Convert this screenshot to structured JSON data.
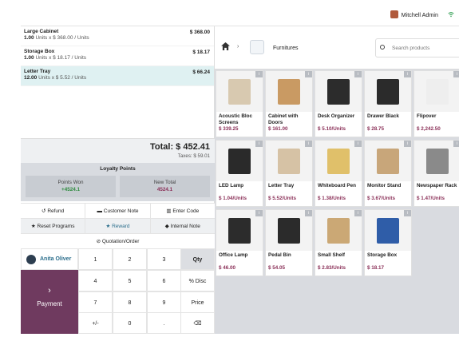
{
  "topbar": {
    "user_name": "Mitchell Admin"
  },
  "orderlines": [
    {
      "name": "Large Cabinet",
      "qty": "1.00",
      "detail": "Units x $ 368.00 / Units",
      "price": "$ 368.00",
      "selected": false
    },
    {
      "name": "Storage Box",
      "qty": "1.00",
      "detail": "Units x $ 18.17 / Units",
      "price": "$ 18.17",
      "selected": false
    },
    {
      "name": "Letter Tray",
      "qty": "12.00",
      "detail": "Units x $ 5.52 / Units",
      "price": "$ 66.24",
      "selected": true
    }
  ],
  "totals": {
    "total": "Total: $ 452.41",
    "taxes": "Taxes: $ 59.01"
  },
  "loyalty": {
    "header": "Loyalty Points",
    "won_label": "Points Won",
    "won_value": "+4524.1",
    "new_label": "New Total",
    "new_value": "4524.1"
  },
  "actions": {
    "refund": "Refund",
    "customer_note": "Customer Note",
    "enter_code": "Enter Code",
    "reset_programs": "Reset Programs",
    "reward": "Reward",
    "internal_note": "Internal Note",
    "quotation": "Quotation/Order"
  },
  "customer": {
    "name": "Anita Oliver"
  },
  "payment": {
    "label": "Payment"
  },
  "numpad": {
    "k1": "1",
    "k2": "2",
    "k3": "3",
    "qty": "Qty",
    "k4": "4",
    "k5": "5",
    "k6": "6",
    "disc": "% Disc",
    "k7": "7",
    "k8": "8",
    "k9": "9",
    "price": "Price",
    "sign": "+/-",
    "k0": "0",
    "dot": ".",
    "back": "⌫"
  },
  "category": {
    "label": "Furnitures",
    "search_placeholder": "Search products"
  },
  "products": [
    {
      "name": "Acoustic Bloc Screens",
      "price": "$ 339.25"
    },
    {
      "name": "Cabinet with Doors",
      "price": "$ 161.00"
    },
    {
      "name": "Desk Organizer",
      "price": "$ 5.10/Units"
    },
    {
      "name": "Drawer Black",
      "price": "$ 28.75"
    },
    {
      "name": "Flipover",
      "price": "$ 2,242.50"
    },
    {
      "name": "LED Lamp",
      "price": "$ 1.04/Units"
    },
    {
      "name": "Letter Tray",
      "price": "$ 5.52/Units"
    },
    {
      "name": "Whiteboard Pen",
      "price": "$ 1.38/Units"
    },
    {
      "name": "Monitor Stand",
      "price": "$ 3.67/Units"
    },
    {
      "name": "Newspaper Rack",
      "price": "$ 1.47/Units"
    },
    {
      "name": "Office Lamp",
      "price": "$ 46.00"
    },
    {
      "name": "Pedal Bin",
      "price": "$ 54.05"
    },
    {
      "name": "Small Shelf",
      "price": "$ 2.83/Units"
    },
    {
      "name": "Storage Box",
      "price": "$ 18.17"
    }
  ],
  "colors": {
    "accent": "#6f3a5f",
    "price": "#8a2f57",
    "selected_line": "#dff1f2"
  }
}
